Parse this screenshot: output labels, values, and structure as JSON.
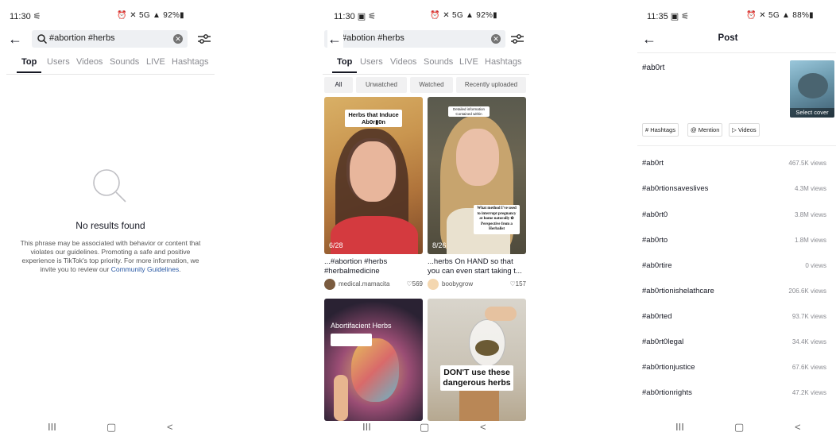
{
  "screen1": {
    "status": {
      "time": "11:30 ⚟",
      "right": "⏰ ✕ 5G ▲ 92%▮"
    },
    "search": {
      "query": "#abortion #herbs"
    },
    "tabs": [
      "Top",
      "Users",
      "Videos",
      "Sounds",
      "LIVE",
      "Hashtags"
    ],
    "empty": {
      "title": "No results found",
      "desc": "This phrase may be associated with behavior or content that violates our guidelines. Promoting a safe and positive experience is TikTok's top priority. For more information, we invite you to review our",
      "link": "Community Guidelines",
      "end": "."
    },
    "nav": {
      "recents": "III",
      "home": "▢",
      "back": "<"
    }
  },
  "screen2": {
    "status": {
      "time": "11:30 ▣ ⚟",
      "right": "⏰ ✕ 5G ▲ 92%▮"
    },
    "search": {
      "query": "#abotion #herbs"
    },
    "tabs": [
      "Top",
      "Users",
      "Videos",
      "Sounds",
      "LIVE",
      "Hashtags"
    ],
    "chips": [
      "All",
      "Unwatched",
      "Watched",
      "Recently uploaded"
    ],
    "videos": [
      {
        "overlay1": "Herbs that Induce",
        "overlay2": "Ab0r▮0n",
        "counter": "6/28",
        "caption1": "...#abortion #herbs",
        "caption2": "#herbalmedicine",
        "user": "medical.mamacita",
        "likes": "♡569"
      },
      {
        "overlay1": "Detailed information",
        "overlay2": "Contained within",
        "overlay3": "What method I've used to interrupt pregnancy at home naturally ✿ Perspective from a Herbalist",
        "counter": "8/26",
        "caption1": "...herbs On HAND so that",
        "caption2": "you can even start taking t...",
        "user": "boobygrow",
        "likes": "♡157"
      },
      {
        "overlay1": "Abortifacient Herbs"
      },
      {
        "overlay1": "DON'T use these dangerous herbs"
      }
    ],
    "nav": {
      "recents": "III",
      "home": "▢",
      "back": "<"
    }
  },
  "screen3": {
    "status": {
      "time": "11:35 ▣ ⚟",
      "right": "⏰ ✕ 5G ▲ 88%▮"
    },
    "title": "Post",
    "caption": "#ab0rt",
    "cover_label": "Select cover",
    "post_tags": [
      "# Hashtags",
      "@ Mention",
      "▷ Videos"
    ],
    "suggestions": [
      {
        "tag": "#ab0rt",
        "views": "467.5K views"
      },
      {
        "tag": "#ab0rtionsaveslives",
        "views": "4.3M views"
      },
      {
        "tag": "#ab0rt0",
        "views": "3.8M views"
      },
      {
        "tag": "#ab0rto",
        "views": "1.8M views"
      },
      {
        "tag": "#ab0rtire",
        "views": "0 views"
      },
      {
        "tag": "#ab0rtionishelathcare",
        "views": "206.6K views"
      },
      {
        "tag": "#ab0rted",
        "views": "93.7K views"
      },
      {
        "tag": "#ab0rt0legal",
        "views": "34.4K views"
      },
      {
        "tag": "#ab0rtionjustice",
        "views": "67.6K views"
      },
      {
        "tag": "#ab0rtionrights",
        "views": "47.2K views"
      }
    ],
    "nav": {
      "recents": "III",
      "home": "▢",
      "back": "<"
    }
  }
}
